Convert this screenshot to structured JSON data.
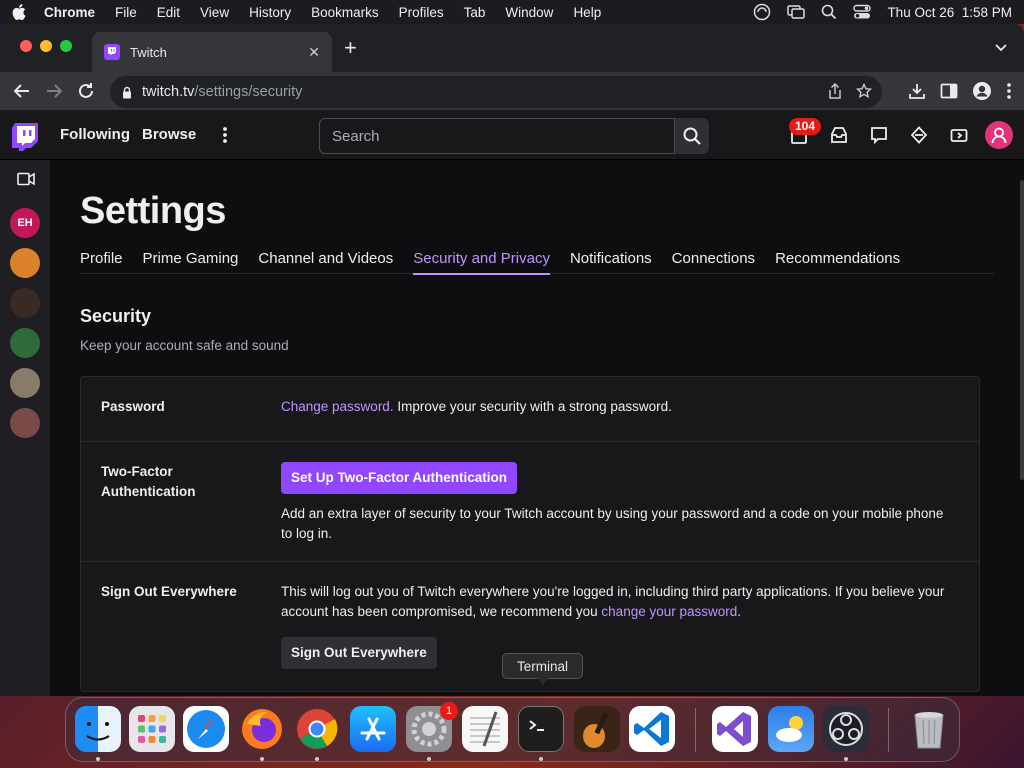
{
  "menubar": {
    "app": "Chrome",
    "items": [
      "File",
      "Edit",
      "View",
      "History",
      "Bookmarks",
      "Profiles",
      "Tab",
      "Window",
      "Help"
    ],
    "datetime": "Thu Oct 26  1:58 PM"
  },
  "browser": {
    "tab_title": "Twitch",
    "url_host": "twitch.tv",
    "url_path": "/settings/security"
  },
  "twitch": {
    "nav_following": "Following",
    "nav_browse": "Browse",
    "search_placeholder": "Search",
    "notification_count": "104",
    "sidebar_channel_initials": "EH"
  },
  "page": {
    "title": "Settings",
    "tabs": [
      {
        "label": "Profile",
        "active": false
      },
      {
        "label": "Prime Gaming",
        "active": false
      },
      {
        "label": "Channel and Videos",
        "active": false
      },
      {
        "label": "Security and Privacy",
        "active": true
      },
      {
        "label": "Notifications",
        "active": false
      },
      {
        "label": "Connections",
        "active": false
      },
      {
        "label": "Recommendations",
        "active": false
      }
    ],
    "section_title": "Security",
    "section_subtitle": "Keep your account safe and sound",
    "password": {
      "label": "Password",
      "link": "Change password.",
      "text": " Improve your security with a strong password."
    },
    "two_factor": {
      "label_line1": "Two-Factor",
      "label_line2": "Authentication",
      "button": "Set Up Two-Factor Authentication",
      "text": "Add an extra layer of security to your Twitch account by using your password and a code on your mobile phone to log in."
    },
    "sign_out": {
      "label": "Sign Out Everywhere",
      "text": "This will log out you of Twitch everywhere you're logged in, including third party applications. If you believe your account has been compromised, we recommend you ",
      "link": "change your password",
      "text_end": ".",
      "button": "Sign Out Everywhere"
    }
  },
  "dock": {
    "tooltip": "Terminal",
    "settings_badge": "1",
    "apps": [
      "finder",
      "launchpad",
      "safari",
      "firefox",
      "chrome",
      "app-store",
      "system-settings",
      "textedit",
      "terminal",
      "garageband",
      "vscode",
      "visual-studio",
      "weather",
      "obs",
      "trash"
    ]
  },
  "colors": {
    "twitch_purple": "#9147ff",
    "link_purple": "#bf94ff",
    "badge_red": "#e91916"
  }
}
